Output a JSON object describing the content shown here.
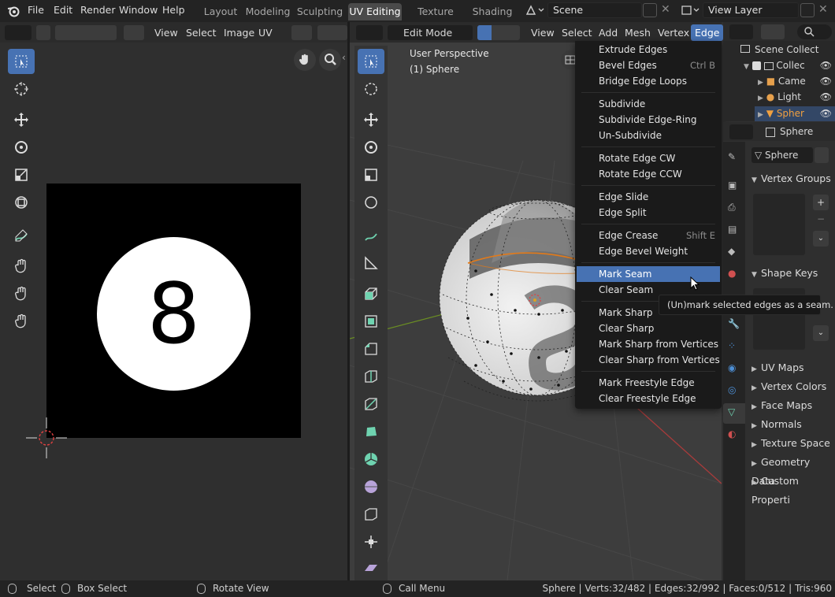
{
  "topbar": {
    "menus": [
      "File",
      "Edit",
      "Render",
      "Window",
      "Help"
    ],
    "workspaces": [
      "Layout",
      "Modeling",
      "Sculpting",
      "UV Editing",
      "Texture Paint",
      "Shading"
    ],
    "active_workspace": "UV Editing",
    "scene_name": "Scene",
    "view_layer": "View Layer"
  },
  "uv_editor": {
    "menus": [
      "View",
      "Select",
      "Image",
      "UV"
    ],
    "image_number": "8"
  },
  "viewport": {
    "mode": "Edit Mode",
    "menus": [
      "View",
      "Select",
      "Add",
      "Mesh",
      "Vertex",
      "Edge"
    ],
    "active_menu": "Edge",
    "overlay_line1": "User Perspective",
    "overlay_line2": "(1) Sphere"
  },
  "edge_menu": {
    "items": [
      {
        "label": "Extrude Edges",
        "shortcut": ""
      },
      {
        "label": "Bevel Edges",
        "shortcut": "Ctrl B"
      },
      {
        "label": "Bridge Edge Loops",
        "shortcut": ""
      },
      {
        "label": "Subdivide",
        "shortcut": ""
      },
      {
        "label": "Subdivide Edge-Ring",
        "shortcut": ""
      },
      {
        "label": "Un-Subdivide",
        "shortcut": ""
      },
      {
        "label": "Rotate Edge CW",
        "shortcut": ""
      },
      {
        "label": "Rotate Edge CCW",
        "shortcut": ""
      },
      {
        "label": "Edge Slide",
        "shortcut": ""
      },
      {
        "label": "Edge Split",
        "shortcut": ""
      },
      {
        "label": "Edge Crease",
        "shortcut": "Shift E"
      },
      {
        "label": "Edge Bevel Weight",
        "shortcut": ""
      },
      {
        "label": "Mark Seam",
        "shortcut": ""
      },
      {
        "label": "Clear Seam",
        "shortcut": ""
      },
      {
        "label": "Mark Sharp",
        "shortcut": ""
      },
      {
        "label": "Clear Sharp",
        "shortcut": ""
      },
      {
        "label": "Mark Sharp from Vertices",
        "shortcut": ""
      },
      {
        "label": "Clear Sharp from Vertices",
        "shortcut": ""
      },
      {
        "label": "Mark Freestyle Edge",
        "shortcut": ""
      },
      {
        "label": "Clear Freestyle Edge",
        "shortcut": ""
      }
    ],
    "highlighted": "Mark Seam",
    "tooltip": "(Un)mark selected edges as a seam."
  },
  "outliner": {
    "root": "Scene Collect",
    "items": [
      "Collec",
      "Came",
      "Light",
      "Spher"
    ]
  },
  "properties": {
    "object_name": "Sphere",
    "data_name": "Sphere",
    "panels": [
      "Vertex Groups",
      "Shape Keys",
      "UV Maps",
      "Vertex Colors",
      "Face Maps",
      "Normals",
      "Texture Space",
      "Geometry Data",
      "Custom Properti"
    ]
  },
  "statusbar": {
    "select": "Select",
    "box_select": "Box Select",
    "rotate_view": "Rotate View",
    "call_menu": "Call Menu",
    "stats": "Sphere | Verts:32/482 | Edges:32/992 | Faces:0/512 | Tris:960"
  },
  "colors": {
    "accent": "#4772b3",
    "seam_edge": "#e27a1a",
    "background": "#303030"
  }
}
